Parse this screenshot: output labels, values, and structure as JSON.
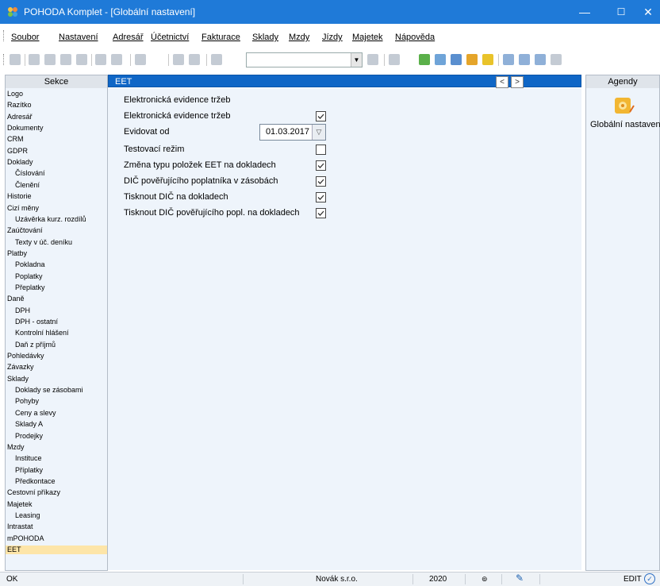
{
  "window": {
    "title": "POHODA Komplet - [Globální nastavení]",
    "minimize": "—",
    "maximize": "☐",
    "close": "✕"
  },
  "menu": [
    {
      "label": "Soubor"
    },
    {
      "label": "Nastavení"
    },
    {
      "label": "Adresář"
    },
    {
      "label": "Účetnictví"
    },
    {
      "label": "Fakturace"
    },
    {
      "label": "Sklady"
    },
    {
      "label": "Mzdy"
    },
    {
      "label": "Jízdy"
    },
    {
      "label": "Majetek"
    },
    {
      "label": "Nápověda"
    }
  ],
  "panes": {
    "sekce": "Sekce",
    "agendy": "Agendy",
    "eet": "EET",
    "nav_prev": "<",
    "nav_next": ">"
  },
  "sidebar": {
    "items": [
      "Logo",
      "Razítko",
      "Adresář",
      "Dokumenty",
      "CRM",
      "GDPR",
      "Doklady",
      "Číslování",
      "Členění",
      "Historie",
      "Cizí měny",
      "Uzávěrka kurz. rozdílů",
      "Zaúčtování",
      "Texty v úč. deníku",
      "Platby",
      "Pokladna",
      "Poplatky",
      "Přeplatky",
      "Daně",
      "DPH",
      "DPH - ostatní",
      "Kontrolní hlášení",
      "Daň z příjmů",
      "Pohledávky",
      "Závazky",
      "Sklady",
      "Doklady se zásobami",
      "Pohyby",
      "Ceny a slevy",
      "Sklady A",
      "Prodejky",
      "Mzdy",
      "Instituce",
      "Příplatky",
      "Předkontace",
      "Cestovní příkazy",
      "Majetek",
      "Leasing",
      "Intrastat",
      "mPOHODA",
      "EET"
    ],
    "selected": "EET"
  },
  "form": {
    "section_title": "Elektronická evidence tržeb",
    "rows": [
      {
        "label": "Elektronická evidence tržeb",
        "checked": true
      },
      {
        "label": "Evidovat od",
        "date": "01.03.2017"
      },
      {
        "label": "Testovací režim",
        "checked": false
      },
      {
        "label": "Změna typu položek EET na dokladech",
        "checked": true
      },
      {
        "label": "DIČ pověřujícího poplatníka v zásobách",
        "checked": true
      },
      {
        "label": "Tisknout DIČ na dokladech",
        "checked": true
      },
      {
        "label": "Tisknout DIČ pověřujícího popl. na dokladech",
        "checked": true
      }
    ]
  },
  "agendy": {
    "label": "Globální nastavení"
  },
  "status": {
    "left": "OK",
    "company": "Novák s.r.o.",
    "year": "2020",
    "mode": "EDIT"
  },
  "colors": {
    "titlebar": "#1f7ad8",
    "pane_header": "#0f66c6",
    "panel_bg": "#eef4fb",
    "selected": "#fde5a8"
  }
}
